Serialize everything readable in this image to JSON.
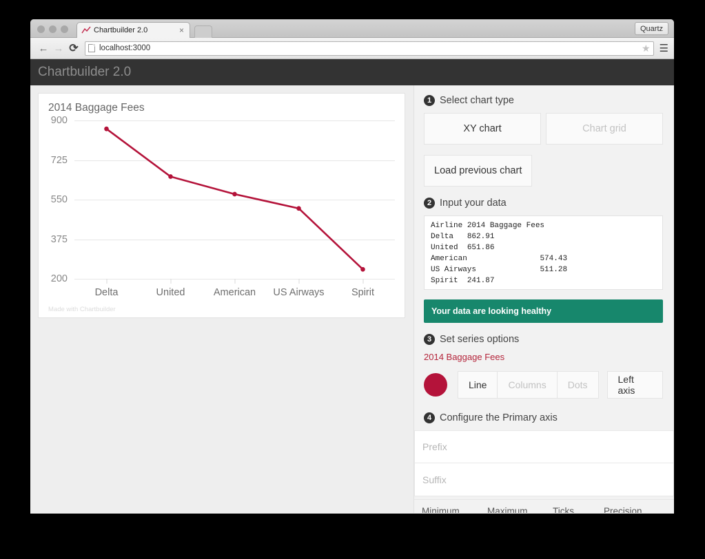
{
  "browser": {
    "tab_title": "Chartbuilder 2.0",
    "tab_close": "×",
    "quartz_button": "Quartz",
    "back_icon": "←",
    "forward_icon": "→",
    "reload_icon": "⟳",
    "url": "localhost:3000",
    "star_icon": "★",
    "menu_icon": "☰"
  },
  "app": {
    "title": "Chartbuilder 2.0"
  },
  "chart_card": {
    "credit": "Made with Chartbuilder"
  },
  "chart_data": {
    "type": "line",
    "title": "2014 Baggage Fees",
    "xlabel": "",
    "ylabel": "",
    "categories": [
      "Delta",
      "United",
      "American",
      "US Airways",
      "Spirit"
    ],
    "values": [
      862.91,
      651.86,
      574.43,
      511.28,
      241.87
    ],
    "series": [
      {
        "name": "2014 Baggage Fees",
        "color": "#b4133a",
        "values": [
          862.91,
          651.86,
          574.43,
          511.28,
          241.87
        ]
      }
    ],
    "yticks": [
      900,
      725,
      550,
      375,
      200
    ],
    "ylim": [
      200,
      900
    ],
    "grid": true,
    "legend": "none",
    "markers": true
  },
  "panel": {
    "step1": {
      "number": "1",
      "label": "Select chart type",
      "options": [
        {
          "label": "XY chart",
          "active": true
        },
        {
          "label": "Chart grid",
          "active": false
        }
      ],
      "load_previous": "Load previous chart"
    },
    "step2": {
      "number": "2",
      "label": "Input your data",
      "data_text": "Airline\t2014 Baggage Fees\nDelta\t862.91\nUnited\t651.86\nAmerican\t\t574.43\nUS Airways\t\t511.28\nSpirit\t241.87",
      "status": "Your data are looking healthy"
    },
    "step3": {
      "number": "3",
      "label": "Set series options",
      "series_name": "2014 Baggage Fees",
      "swatch_color": "#b4133a",
      "types": [
        {
          "label": "Line",
          "active": true
        },
        {
          "label": "Columns",
          "active": false
        },
        {
          "label": "Dots",
          "active": false
        }
      ],
      "axis_button": "Left axis"
    },
    "step4": {
      "number": "4",
      "label": "Configure the Primary axis",
      "prefix_placeholder": "Prefix",
      "prefix_value": "",
      "suffix_placeholder": "Suffix",
      "suffix_value": "",
      "columns": [
        "Minimum",
        "Maximum",
        "Ticks",
        "Precision"
      ]
    }
  }
}
